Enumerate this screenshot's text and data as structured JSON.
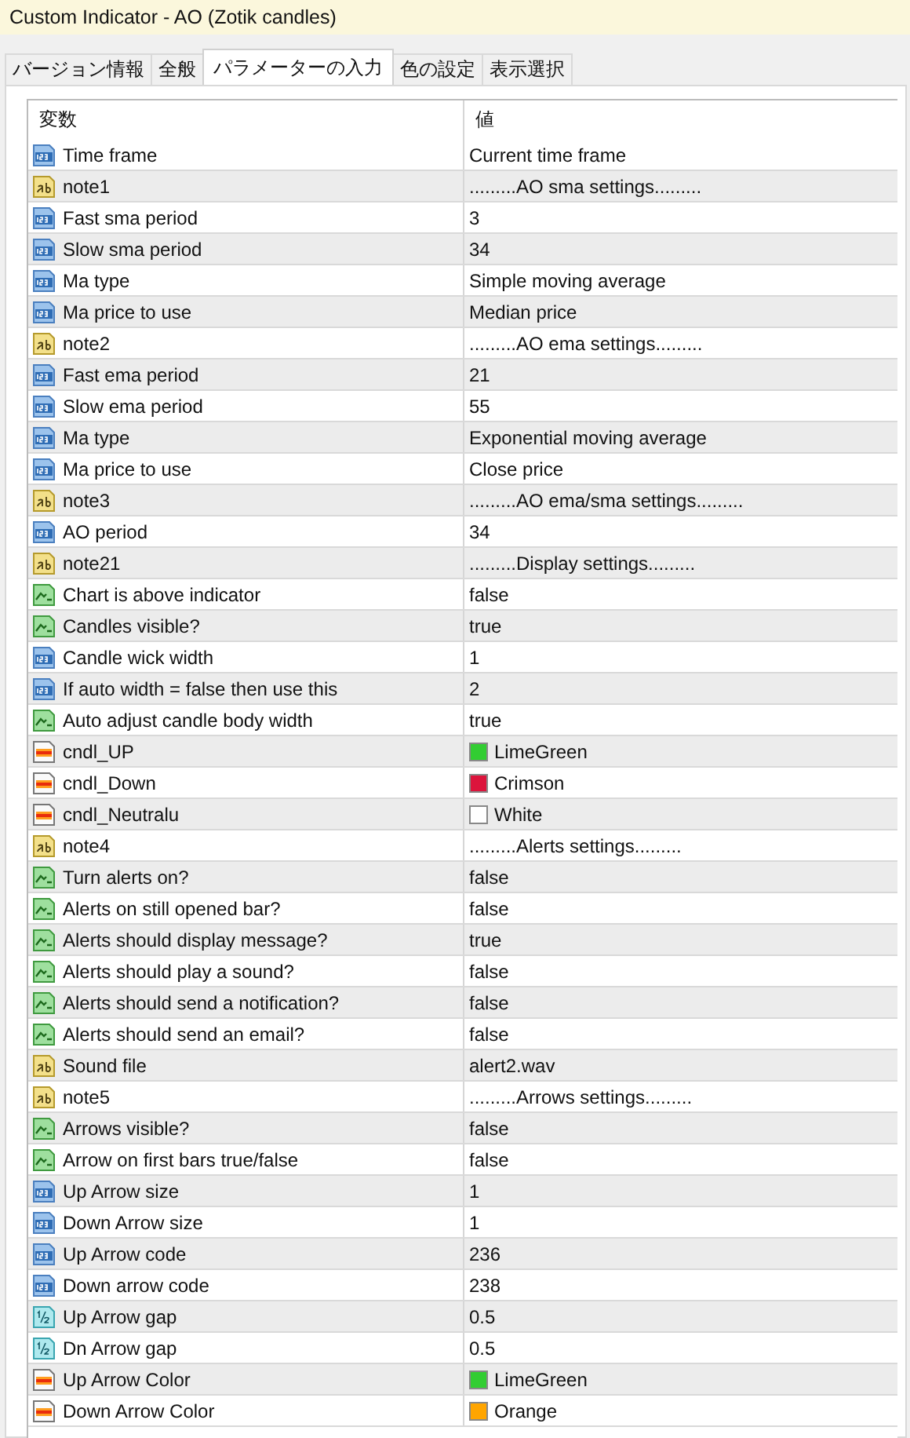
{
  "window": {
    "title": "Custom Indicator - AO (Zotik candles)"
  },
  "tabs": [
    {
      "label": "バージョン情報",
      "selected": false
    },
    {
      "label": "全般",
      "selected": false
    },
    {
      "label": "パラメーターの入力",
      "selected": true
    },
    {
      "label": "色の設定",
      "selected": false
    },
    {
      "label": "表示選択",
      "selected": false
    }
  ],
  "table": {
    "columns": [
      "変数",
      "値"
    ],
    "rows": [
      {
        "kind": "int",
        "name": "Time frame",
        "value": "Current time frame"
      },
      {
        "kind": "string",
        "name": "note1",
        "value": ".........AO sma settings........."
      },
      {
        "kind": "int",
        "name": "Fast sma period",
        "value": "3"
      },
      {
        "kind": "int",
        "name": "Slow sma period",
        "value": "34"
      },
      {
        "kind": "int",
        "name": "Ma type",
        "value": "Simple moving average"
      },
      {
        "kind": "int",
        "name": "Ma price to use",
        "value": "Median price"
      },
      {
        "kind": "string",
        "name": "note2",
        "value": ".........AO ema settings........."
      },
      {
        "kind": "int",
        "name": "Fast ema period",
        "value": "21"
      },
      {
        "kind": "int",
        "name": "Slow ema period",
        "value": "55"
      },
      {
        "kind": "int",
        "name": "Ma type",
        "value": "Exponential moving average"
      },
      {
        "kind": "int",
        "name": "Ma price to use",
        "value": "Close price"
      },
      {
        "kind": "string",
        "name": "note3",
        "value": ".........AO ema/sma settings........."
      },
      {
        "kind": "int",
        "name": "AO period",
        "value": "34"
      },
      {
        "kind": "string",
        "name": "note21",
        "value": ".........Display settings........."
      },
      {
        "kind": "bool",
        "name": "Chart is above indicator",
        "value": "false"
      },
      {
        "kind": "bool",
        "name": "Candles visible?",
        "value": "true"
      },
      {
        "kind": "int",
        "name": "Candle wick width",
        "value": "1"
      },
      {
        "kind": "int",
        "name": "If auto width = false then use this",
        "value": "2"
      },
      {
        "kind": "bool",
        "name": "Auto adjust candle body width",
        "value": "true"
      },
      {
        "kind": "color",
        "name": "cndl_UP",
        "value": "LimeGreen",
        "color": "#32cd32"
      },
      {
        "kind": "color",
        "name": "cndl_Down",
        "value": "Crimson",
        "color": "#dc143c"
      },
      {
        "kind": "color",
        "name": "cndl_Neutralu",
        "value": "White",
        "color": "#ffffff"
      },
      {
        "kind": "string",
        "name": "note4",
        "value": ".........Alerts settings........."
      },
      {
        "kind": "bool",
        "name": "Turn alerts on?",
        "value": "false"
      },
      {
        "kind": "bool",
        "name": "Alerts on still opened bar?",
        "value": "false"
      },
      {
        "kind": "bool",
        "name": "Alerts should display message?",
        "value": "true"
      },
      {
        "kind": "bool",
        "name": "Alerts should play a sound?",
        "value": "false"
      },
      {
        "kind": "bool",
        "name": "Alerts should send a notification?",
        "value": "false"
      },
      {
        "kind": "bool",
        "name": "Alerts should send an email?",
        "value": "false"
      },
      {
        "kind": "string",
        "name": "Sound file",
        "value": "alert2.wav"
      },
      {
        "kind": "string",
        "name": "note5",
        "value": ".........Arrows settings........."
      },
      {
        "kind": "bool",
        "name": "Arrows visible?",
        "value": "false"
      },
      {
        "kind": "bool",
        "name": "Arrow on first bars true/false",
        "value": "false"
      },
      {
        "kind": "int",
        "name": "Up Arrow size",
        "value": "1"
      },
      {
        "kind": "int",
        "name": "Down Arrow size",
        "value": "1"
      },
      {
        "kind": "int",
        "name": "Up Arrow code",
        "value": "236"
      },
      {
        "kind": "int",
        "name": "Down arrow code",
        "value": "238"
      },
      {
        "kind": "double",
        "name": "Up Arrow gap",
        "value": "0.5"
      },
      {
        "kind": "double",
        "name": "Dn Arrow gap",
        "value": "0.5"
      },
      {
        "kind": "color",
        "name": "Up Arrow Color",
        "value": "LimeGreen",
        "color": "#32cd32"
      },
      {
        "kind": "color",
        "name": "Down Arrow Color",
        "value": "Orange",
        "color": "#ffa500"
      }
    ]
  }
}
